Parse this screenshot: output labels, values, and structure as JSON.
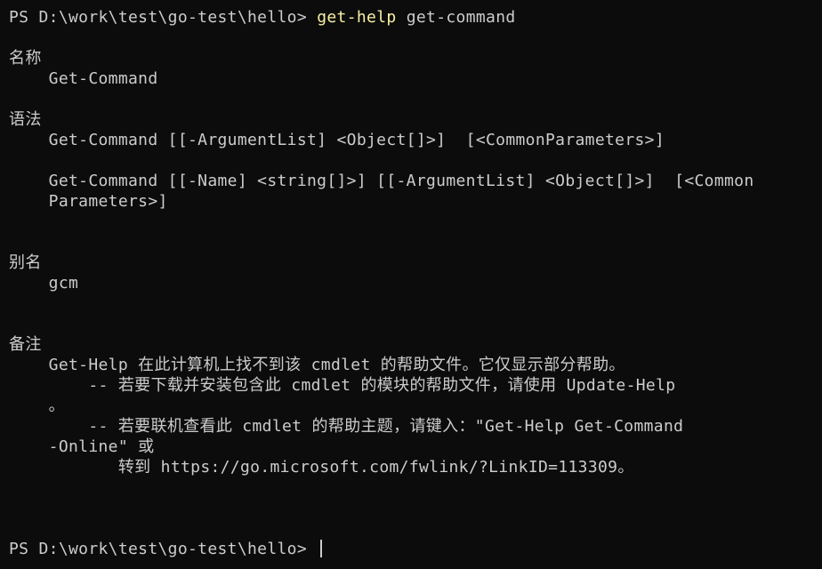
{
  "terminal": {
    "prompt": "PS D:\\work\\test\\go-test\\hello> ",
    "command_name": "get-help",
    "command_args": " get-command",
    "final_prompt": "PS D:\\work\\test\\go-test\\hello> ",
    "colors": {
      "background": "#0c0c0c",
      "foreground": "#cccccc",
      "command": "#f9f1a5"
    }
  },
  "output": {
    "name_heading": "名称",
    "name_value": "    Get-Command",
    "syntax_heading": "语法",
    "syntax_1": "    Get-Command [[-ArgumentList] <Object[]>]  [<CommonParameters>]",
    "syntax_2a": "    Get-Command [[-Name] <string[]>] [[-ArgumentList] <Object[]>]  [<Common",
    "syntax_2b": "    Parameters>]",
    "alias_heading": "别名",
    "alias_value": "    gcm",
    "remarks_heading": "备注",
    "remarks_1": "    Get-Help 在此计算机上找不到该 cmdlet 的帮助文件。它仅显示部分帮助。",
    "remarks_2": "        -- 若要下载并安装包含此 cmdlet 的模块的帮助文件，请使用 Update-Help",
    "remarks_3": "    。",
    "remarks_4": "        -- 若要联机查看此 cmdlet 的帮助主题，请键入：\"Get-Help Get-Command",
    "remarks_5": "    -Online\" 或",
    "remarks_6": "           转到 https://go.microsoft.com/fwlink/?LinkID=113309。"
  }
}
